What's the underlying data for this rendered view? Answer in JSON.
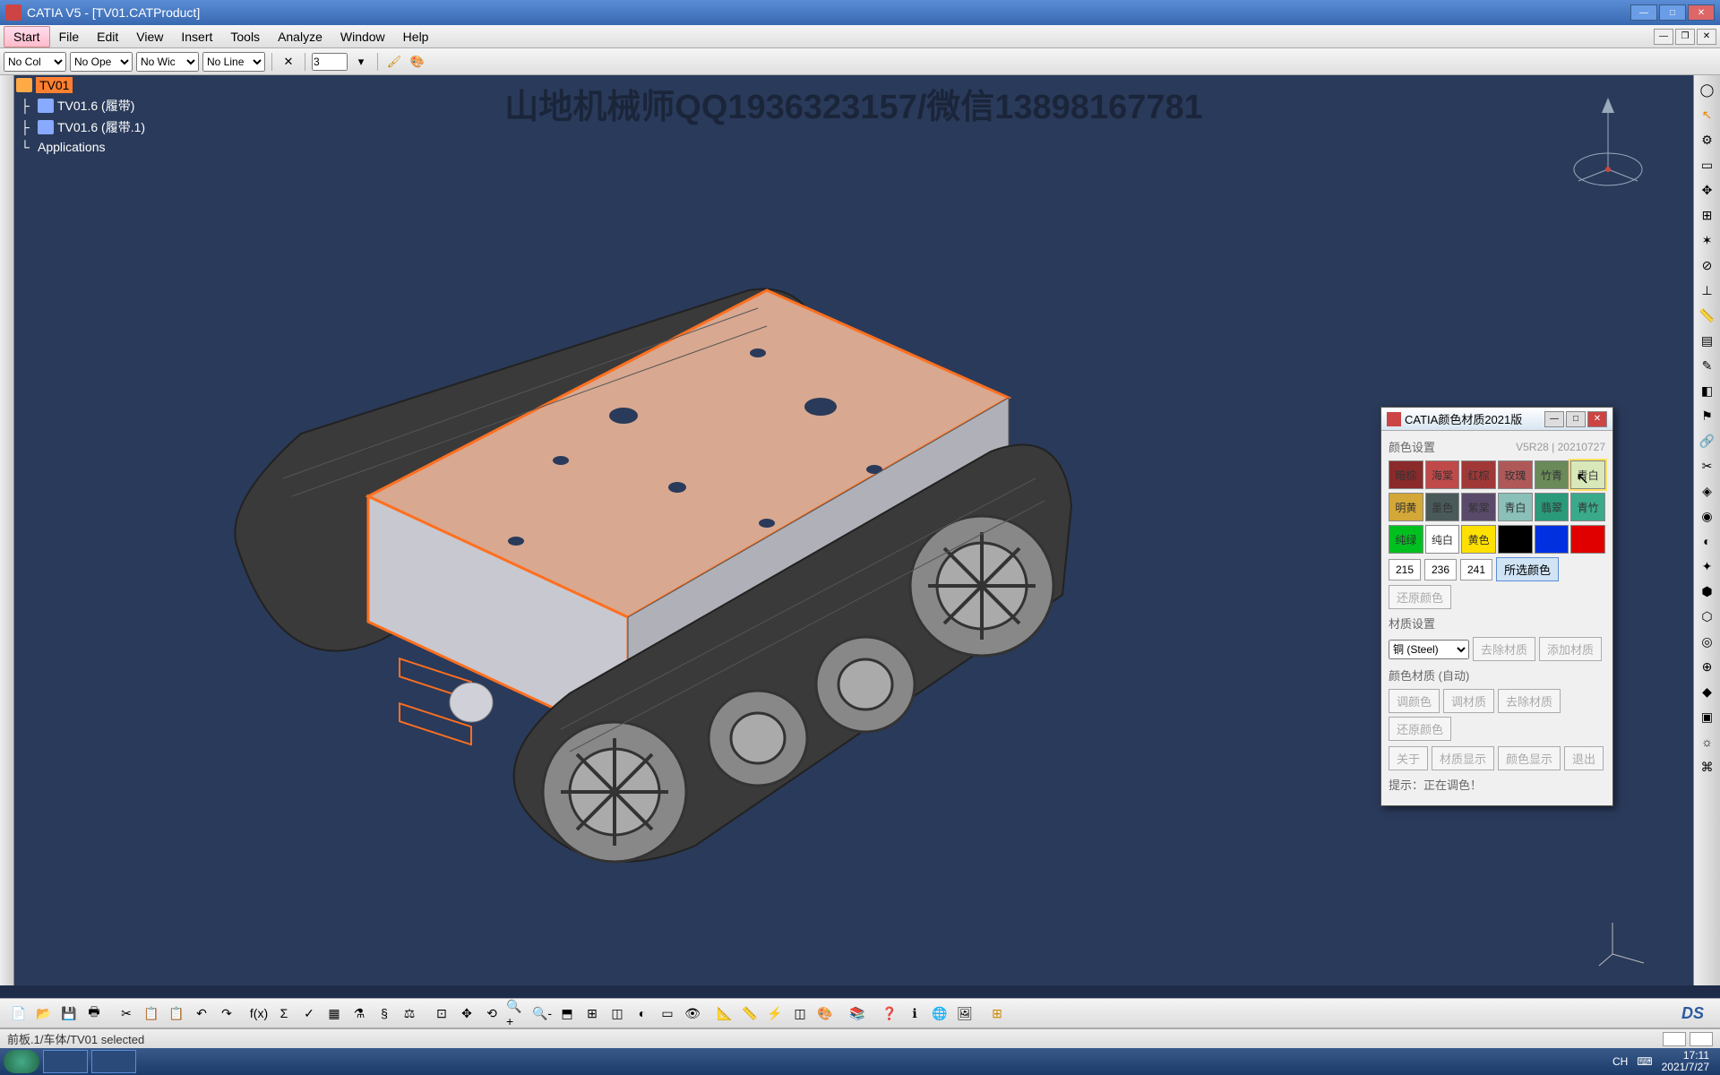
{
  "title": "CATIA V5 - [TV01.CATProduct]",
  "menu": [
    "Start",
    "File",
    "Edit",
    "View",
    "Insert",
    "Tools",
    "Analyze",
    "Window",
    "Help"
  ],
  "opt_selects": [
    "No Col",
    "No Ope",
    "No Wic",
    "No Line"
  ],
  "opt_input": "3",
  "watermark": "山地机械师QQ1936323157/微信13898167781",
  "tree": {
    "root": "TV01",
    "items": [
      "TV01.6 (履带)",
      "TV01.6 (履带.1)",
      "Applications"
    ]
  },
  "dialog": {
    "title": "CATIA颜色材质2021版",
    "section1": "颜色设置",
    "version": "V5R28 | 20210727",
    "swatches1": [
      {
        "l": "暗棕",
        "c": "#8b2a2a"
      },
      {
        "l": "海棠",
        "c": "#c04a4a"
      },
      {
        "l": "红棕",
        "c": "#a03838"
      },
      {
        "l": "玫瑰",
        "c": "#b05858"
      },
      {
        "l": "竹青",
        "c": "#6a8a5a"
      },
      {
        "l": "青白",
        "c": "#d8e8b8"
      }
    ],
    "swatches2": [
      {
        "l": "明黄",
        "c": "#d4a838"
      },
      {
        "l": "墨色",
        "c": "#4a5a5a"
      },
      {
        "l": "紫棠",
        "c": "#5a4a6a"
      },
      {
        "l": "青白",
        "c": "#8ac0b8"
      },
      {
        "l": "翡翠",
        "c": "#2a9a7a"
      },
      {
        "l": "青竹",
        "c": "#3aaa8a"
      }
    ],
    "swatches3": [
      {
        "l": "纯绿",
        "c": "#00c020"
      },
      {
        "l": "纯白",
        "c": "#ffffff"
      },
      {
        "l": "黄色",
        "c": "#ffe000"
      },
      {
        "l": "",
        "c": "#000000"
      },
      {
        "l": "",
        "c": "#0030e0"
      },
      {
        "l": "",
        "c": "#e00000"
      }
    ],
    "rgb": [
      "215",
      "236",
      "241"
    ],
    "btn_selcolor": "所选颜色",
    "btn_restcolor": "还原颜色",
    "section2": "材质设置",
    "material": "铜 (Steel)",
    "btn_delmat": "去除材质",
    "btn_addmat": "添加材质",
    "section3": "颜色材质 (自动)",
    "row4": [
      "调颜色",
      "调材质",
      "去除材质",
      "还原颜色"
    ],
    "row5": [
      "关于",
      "材质显示",
      "颜色显示",
      "退出"
    ],
    "hint": "提示：正在调色！"
  },
  "status": "前板.1/车体/TV01 selected",
  "tray": {
    "ime": "CH",
    "caps": "⌨",
    "time": "17:11",
    "date": "2021/7/27"
  }
}
